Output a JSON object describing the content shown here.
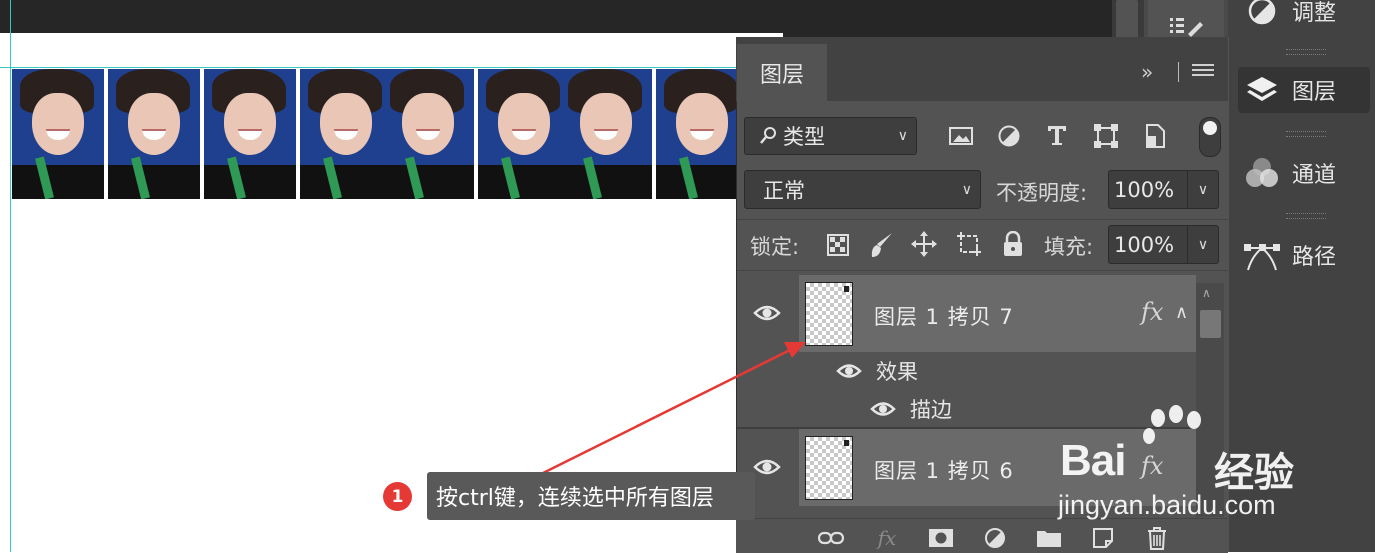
{
  "panel": {
    "tab_label": "图层",
    "tab_arrows": "»",
    "filter": {
      "icon": "search-icon",
      "label": "类型"
    },
    "blend_mode": "正常",
    "opacity_label": "不透明度:",
    "opacity_value": "100%",
    "lock_label": "锁定:",
    "fill_label": "填充:",
    "fill_value": "100%"
  },
  "layers": [
    {
      "name": "图层 1 拷贝 7",
      "fx": "fx",
      "effects_label": "效果",
      "effect": "描边",
      "selected": true
    },
    {
      "name": "图层 1 拷贝 6",
      "fx": "fx",
      "selected": true
    }
  ],
  "dock": {
    "items": [
      {
        "label": "调整",
        "icon": "adjustments-icon"
      },
      {
        "label": "图层",
        "icon": "layers-icon"
      },
      {
        "label": "通道",
        "icon": "channels-icon"
      },
      {
        "label": "路径",
        "icon": "paths-icon"
      }
    ]
  },
  "annotation": {
    "number": "1",
    "text": "按ctrl键，连续选中所有图层"
  },
  "watermark": {
    "brand": "Bai",
    "brand_suffix": "经验",
    "url": "jingyan.baidu.com"
  },
  "colors": {
    "panel_bg": "#535353",
    "selected_row": "#6a6a6a",
    "guide": "#35c9c4",
    "annotation_red": "#e53935"
  }
}
